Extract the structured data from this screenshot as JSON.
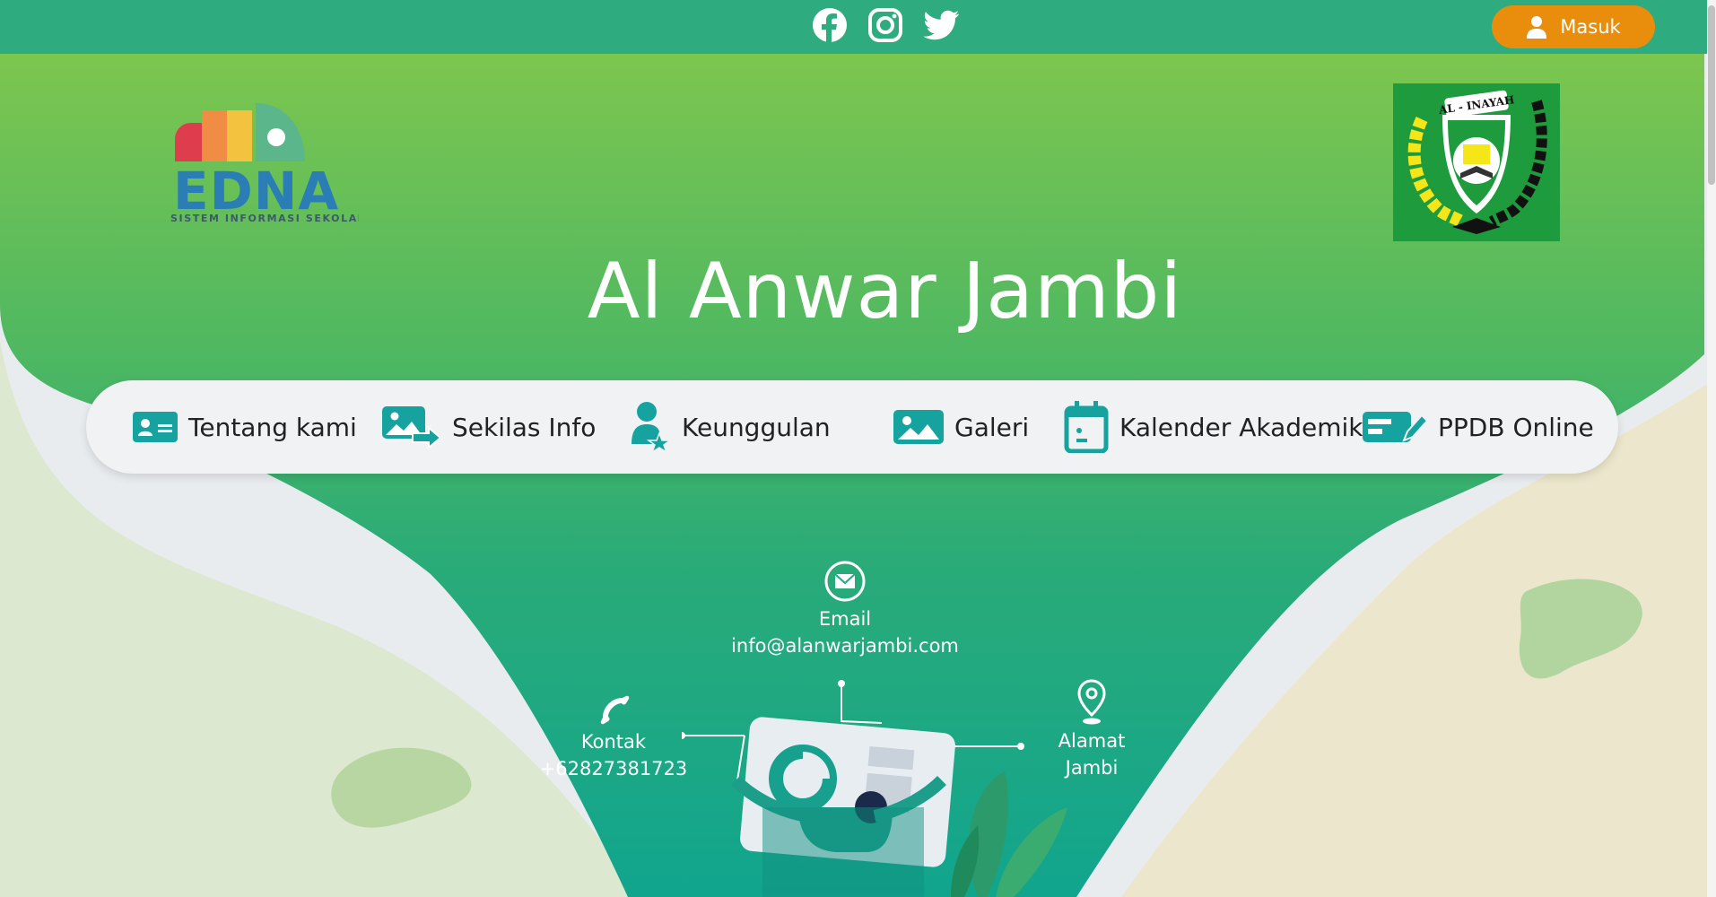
{
  "topbar": {
    "social_icons": [
      "facebook-icon",
      "instagram-icon",
      "twitter-icon"
    ],
    "login_label": "Masuk",
    "login_icon": "user-icon",
    "background_color": "#2fab80",
    "login_button_color": "#e98e0c"
  },
  "branding": {
    "edna_wordmark": "EDNA",
    "edna_tagline": "SISTEM INFORMASI SEKOLAH",
    "school_emblem_text": "AL - INAYAH",
    "site_title": "Al Anwar Jambi"
  },
  "nav": {
    "items": [
      {
        "label": "Tentang kami",
        "icon": "id-card-icon"
      },
      {
        "label": "Sekilas Info",
        "icon": "image-share-icon"
      },
      {
        "label": "Keunggulan",
        "icon": "user-star-icon"
      },
      {
        "label": "Galeri",
        "icon": "image-icon"
      },
      {
        "label": "Kalender Akademik",
        "icon": "calendar-icon"
      },
      {
        "label": "PPDB Online",
        "icon": "edit-form-icon"
      }
    ],
    "icon_color": "#16a3a0"
  },
  "contact": {
    "email": {
      "label": "Email",
      "value": "info@alanwarjambi.com",
      "icon": "envelope-icon"
    },
    "phone": {
      "label": "Kontak",
      "value": "+62827381723",
      "icon": "phone-icon"
    },
    "address": {
      "label": "Alamat",
      "value": "Jambi",
      "icon": "map-pin-icon"
    }
  }
}
